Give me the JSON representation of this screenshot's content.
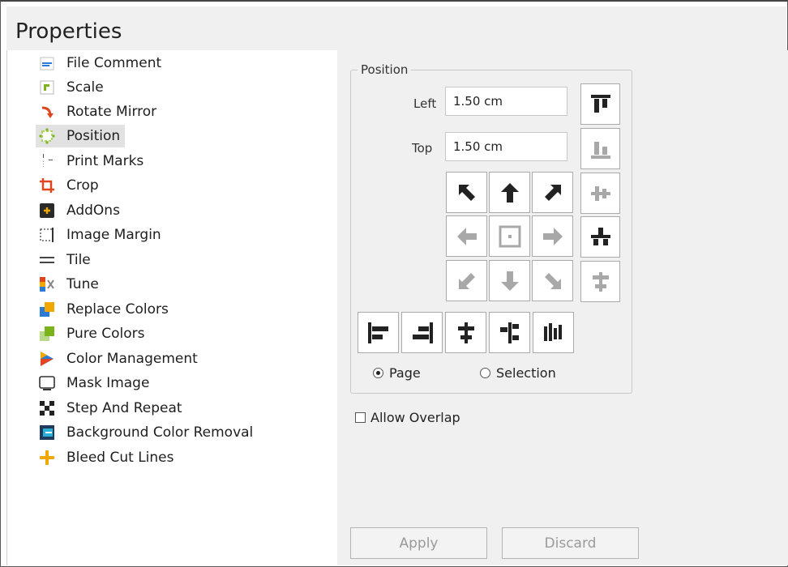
{
  "window": {
    "title": "Properties"
  },
  "sidebar": {
    "items": [
      {
        "label": "File Comment",
        "icon": "file-comment-icon"
      },
      {
        "label": "Scale",
        "icon": "scale-icon"
      },
      {
        "label": "Rotate Mirror",
        "icon": "rotate-mirror-icon"
      },
      {
        "label": "Position",
        "icon": "position-icon",
        "selected": true
      },
      {
        "label": "Print Marks",
        "icon": "print-marks-icon"
      },
      {
        "label": "Crop",
        "icon": "crop-icon"
      },
      {
        "label": "AddOns",
        "icon": "addons-icon"
      },
      {
        "label": "Image Margin",
        "icon": "image-margin-icon"
      },
      {
        "label": "Tile",
        "icon": "tile-icon"
      },
      {
        "label": "Tune",
        "icon": "tune-icon"
      },
      {
        "label": "Replace Colors",
        "icon": "replace-colors-icon"
      },
      {
        "label": "Pure Colors",
        "icon": "pure-colors-icon"
      },
      {
        "label": "Color Management",
        "icon": "color-management-icon"
      },
      {
        "label": "Mask Image",
        "icon": "mask-image-icon"
      },
      {
        "label": "Step And Repeat",
        "icon": "step-and-repeat-icon"
      },
      {
        "label": "Background Color Removal",
        "icon": "background-color-removal-icon"
      },
      {
        "label": "Bleed Cut Lines",
        "icon": "bleed-cut-lines-icon"
      }
    ]
  },
  "position_panel": {
    "group_title": "Position",
    "left_label": "Left",
    "left_value": "1.50 cm",
    "top_label": "Top",
    "top_value": "1.50 cm",
    "radio_page": "Page",
    "radio_selection": "Selection",
    "selected_reference": "Page",
    "allow_overlap_label": "Allow Overlap",
    "allow_overlap_checked": false
  },
  "actions": {
    "apply_label": "Apply",
    "discard_label": "Discard",
    "enabled": false
  },
  "colors": {
    "title_bar_bg": "#f0f0f0",
    "pane_bg": "#f0f0f0",
    "icon_dark": "#222222",
    "icon_disabled": "#a8a8a8",
    "selected_item_bg": "#e2e2e2"
  }
}
